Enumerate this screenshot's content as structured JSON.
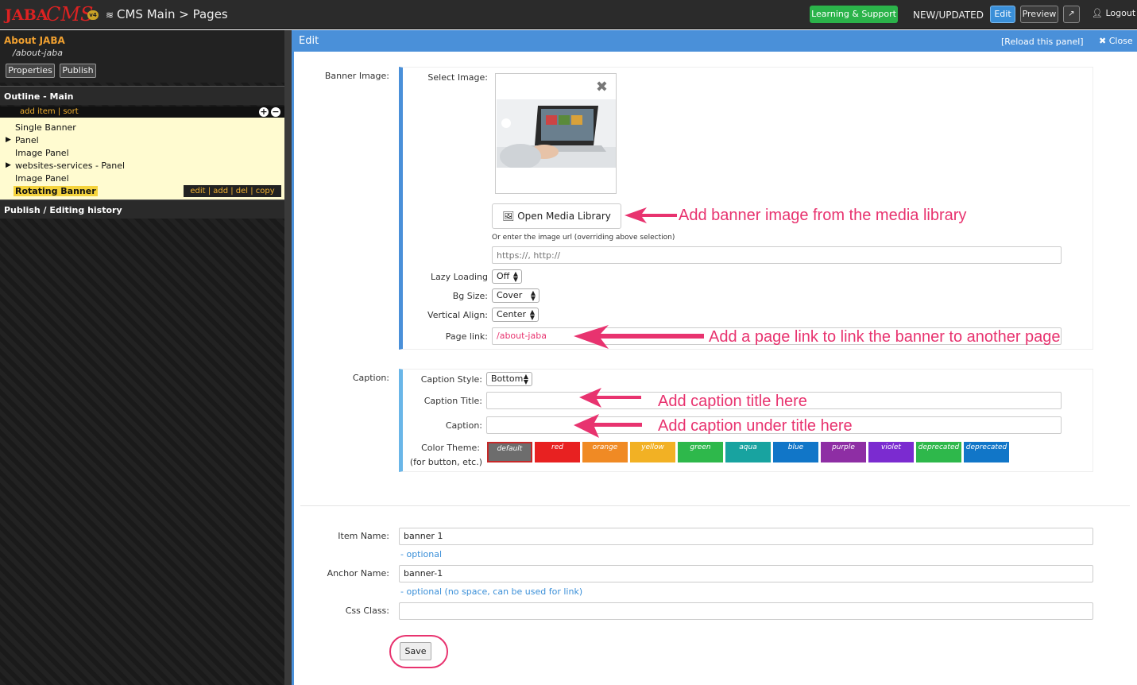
{
  "topbar": {
    "logo_text": "JABA",
    "logo_script": "CMS",
    "logo_version": "v4",
    "breadcrumb": "CMS Main  > Pages",
    "learning": "Learning & Support",
    "newupdated": "NEW/UPDATED",
    "edit": "Edit",
    "preview": "Preview",
    "external": "↗",
    "logout": "Logout"
  },
  "sidebar": {
    "page_title": "About JABA",
    "page_path": "/about-jaba",
    "properties": "Properties",
    "publish": "Publish",
    "outline_header": "Outline - Main",
    "outline_links": "add item  |  sort",
    "items": [
      "Single Banner",
      "Panel",
      "Image Panel",
      "websites-services - Panel",
      "Image Panel",
      "Rotating Banner"
    ],
    "item_actions": "edit  |  add  |  del  |  copy",
    "history_header": "Publish / Editing history"
  },
  "panel": {
    "title": "Edit",
    "reload": "[Reload this panel]",
    "close": "Close",
    "banner_image_label": "Banner Image:",
    "select_image_label": "Select Image:",
    "open_media": "Open Media Library",
    "url_hint": "Or enter the image url (overriding above selection)",
    "url_placeholder": "https://, http://",
    "lazy_label": "Lazy Loading",
    "lazy_value": "Off",
    "bgsize_label": "Bg Size:",
    "bgsize_value": "Cover",
    "valign_label": "Vertical Align:",
    "valign_value": "Center",
    "pagelink_label": "Page link:",
    "pagelink_value": "/about-jaba",
    "caption_label": "Caption:",
    "caption_style_label": "Caption Style:",
    "caption_style_value": "Bottom",
    "caption_title_label": "Caption Title:",
    "caption_field_label": "Caption:",
    "color_theme_label": "Color Theme:",
    "color_theme_sub": "(for button, etc.)",
    "themes": [
      {
        "name": "default",
        "color": "#6d6d6d"
      },
      {
        "name": "red",
        "color": "#e82121"
      },
      {
        "name": "orange",
        "color": "#f08a24"
      },
      {
        "name": "yellow",
        "color": "#f2b124"
      },
      {
        "name": "green",
        "color": "#2eb84b"
      },
      {
        "name": "aqua",
        "color": "#18a3a0"
      },
      {
        "name": "blue",
        "color": "#1176c8"
      },
      {
        "name": "purple",
        "color": "#8e2ea4"
      },
      {
        "name": "violet",
        "color": "#7b2bd0"
      },
      {
        "name": "deprecated",
        "color": "#2eb84b"
      },
      {
        "name": "deprecated",
        "color": "#1176c8"
      }
    ],
    "item_name_label": "Item Name:",
    "item_name_value": "banner 1",
    "item_name_hint": "- optional",
    "anchor_label": "Anchor Name:",
    "anchor_value": "banner-1",
    "anchor_hint": "- optional (no space, can be used for link)",
    "css_label": "Css Class:",
    "save": "Save"
  },
  "annotations": {
    "media": "Add banner image from the media library",
    "pagelink": "Add a page link to link the banner to another page",
    "caption_title": "Add caption title here",
    "caption": "Add caption under title here"
  },
  "colors": {
    "accent": "#4a90d9",
    "annotation": "#e8336f",
    "highlight": "#f5d33c"
  }
}
